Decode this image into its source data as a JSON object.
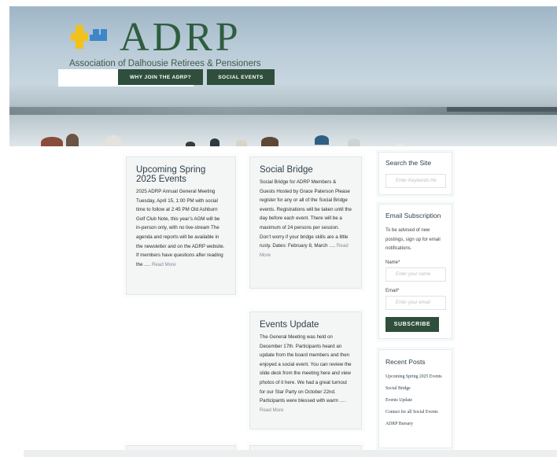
{
  "header": {
    "logo_text": "ADRP",
    "logo_sub": "Association of Dalhousie Retirees & Pensioners",
    "nav": [
      "WHY JOIN THE ADRP?",
      "SOCIAL EVENTS"
    ],
    "colors": {
      "brand_green": "#2f4f3c",
      "logo_yellow": "#f2c21b",
      "logo_blue": "#3d87c9"
    }
  },
  "posts": [
    {
      "title": "Upcoming Spring 2025 Events",
      "excerpt": "2025 ADRP Annual General Meeting Tuesday, April 15, 1:00 PM with social time to follow at 2:45 PM Old Ashburn Golf Club Note, this year’s AGM will be in-person only, with no live-stream The agenda and reports will be available in the newsletter and on the ADRP website. If members have questions after reading the ….",
      "more": "Read More"
    },
    {
      "title": "Social Bridge",
      "excerpt": "Social Bridge for ADRP Members & Guests Hosted by Grace Paterson Please register for any or all of the Social Bridge events. Registrations will be taken until the day before each event. There will be a maximum of 24 persons per session. Don’t worry if your bridge skills are a little rusty. Dates: February 8, March ….",
      "more": "Read More"
    },
    {
      "title": "Events Update",
      "excerpt": "The General Meeting was held on December 17th. Participants heard an update from the board members and then enjoyed a social event. You can review the slide deck from the meeting here and view photos of it here. We had a great turnout for our Star Party on October 22nd. Participants were blessed with warm ….",
      "more": "Read More"
    }
  ],
  "sidebar": {
    "search": {
      "title": "Search the Site",
      "placeholder": "Enter Keywords He"
    },
    "subscription": {
      "title": "Email Subscription",
      "text": "To be advised of new postings, sign up for email notifications.",
      "name_label": "Name*",
      "name_placeholder": "Enter your name",
      "email_label": "Email*",
      "email_placeholder": "Enter your email",
      "button": "SUBSCRIBE"
    },
    "recent": {
      "title": "Recent Posts",
      "items": [
        "Upcoming Spring 2025 Events",
        "Social Bridge",
        "Events Update",
        "Contact for all Social Events",
        "ADRP Bursary"
      ]
    }
  }
}
